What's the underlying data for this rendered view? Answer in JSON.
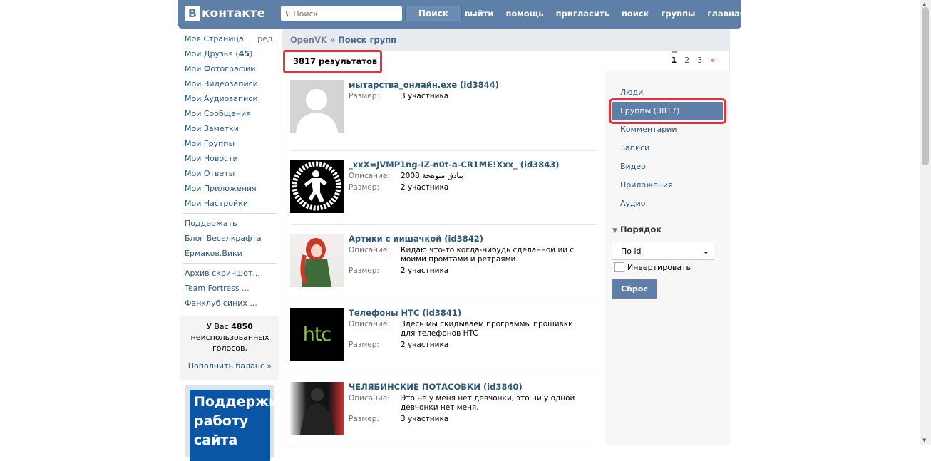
{
  "header": {
    "logo_letter": "В",
    "logo_text": "контакте",
    "search_placeholder": "Поиск",
    "search_button": "Поиск",
    "nav": [
      "выйти",
      "помощь",
      "пригласить",
      "поиск",
      "группы",
      "главная"
    ]
  },
  "sidebar": {
    "my_page": "Моя Страница",
    "edit": "ред.",
    "friends": "Мои Друзья",
    "friends_count": "45",
    "items": [
      "Мои Фотографии",
      "Мои Видеозаписи",
      "Мои Аудиозаписи",
      "Мои Сообщения",
      "Мои Заметки",
      "Мои Группы",
      "Мои Новости",
      "Мои Ответы",
      "Мои Приложения",
      "Мои Настройки"
    ],
    "links": [
      "Поддержать",
      "Блог Веселкрафта",
      "Ермаков.Вики"
    ],
    "groups": [
      "Архив скриншот...",
      "Team Fortress ...",
      "Фанклуб синих ..."
    ],
    "votes_prefix": "У Вас",
    "votes_count": "4850",
    "votes_suffix": "неиспользованных голосов.",
    "refill": "Пополнить баланс »",
    "ad_text": "Поддержи работу сайта"
  },
  "main": {
    "breadcrumb_root": "OpenVK",
    "breadcrumb_sep": "»",
    "breadcrumb_page": "Поиск групп",
    "results_count": "3817 результатов",
    "pages": [
      "1",
      "2",
      "3",
      "»"
    ],
    "label_desc": "Описание:",
    "label_size": "Размер:",
    "results": [
      {
        "title": "мытарства_онлайн.exe (id3844)",
        "desc": null,
        "size": "3 участника"
      },
      {
        "title": "_xxX=JVMP1ng-IZ-n0t-a-CR1ME!Xxx_ (id3843)",
        "desc": "بنادق متوهجة 2008",
        "size": "2 участника"
      },
      {
        "title": "Артики с иишачкой (id3842)",
        "desc": "Кидаю что-то когда-нибудь сделанной ии с моими промтами и ретраями",
        "size": "2 участника"
      },
      {
        "title": "Телефоны HTC (id3841)",
        "desc": "Здесь мы скидываем программы прошивки для телефонов HTC",
        "size": "2 участника"
      },
      {
        "title": "ЧЕЛЯБИНСКИЕ ПОТАСОВКИ (id3840)",
        "desc": "Это не у меня нет девчонки, это ни у одной девчонки нет меня.",
        "size": "3 участника"
      }
    ],
    "htc_logo": "htc"
  },
  "filters": {
    "tabs": [
      "Люди",
      "Группы (3817)",
      "Комментарии",
      "Записи",
      "Видео",
      "Приложения",
      "Аудио"
    ],
    "active": 1,
    "order_title": "Порядок",
    "order_value": "По id",
    "invert": "Инвертировать",
    "reset": "Сброс"
  }
}
